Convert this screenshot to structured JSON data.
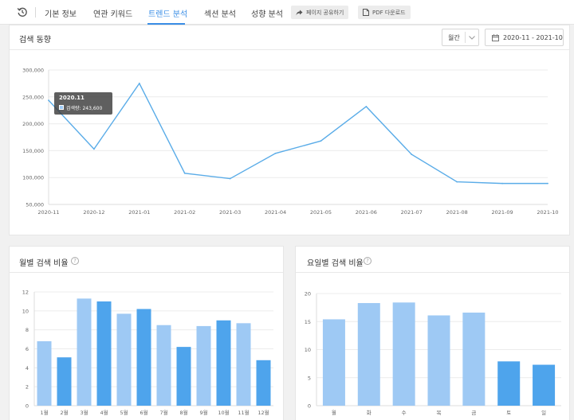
{
  "nav": {
    "tabs": [
      {
        "label": "기본 정보"
      },
      {
        "label": "연관 키워드"
      },
      {
        "label": "트렌드 분석"
      },
      {
        "label": "섹션 분석"
      },
      {
        "label": "성향 분석"
      }
    ],
    "share_label": "페이지 공유하기",
    "pdf_label": "PDF 다운로드"
  },
  "trend": {
    "title": "검색 동향",
    "period_select": "월간",
    "date_range": "2020-11 - 2021-10",
    "tooltip": {
      "title": "2020.11",
      "label": "검색량: 243,600"
    }
  },
  "monthly": {
    "title": "월별 검색 비율"
  },
  "weekday": {
    "title": "요일별 검색 비율"
  },
  "colors": {
    "line": "#5aace8",
    "bar_light": "#9ec9f4",
    "bar_dark": "#4ea4ec",
    "accent": "#3a8ee6"
  },
  "chart_data": [
    {
      "type": "line",
      "x": [
        "2020-11",
        "2020-12",
        "2021-01",
        "2021-02",
        "2021-03",
        "2021-04",
        "2021-05",
        "2021-06",
        "2021-07",
        "2021-08",
        "2021-09",
        "2021-10"
      ],
      "values": [
        243600,
        153000,
        275000,
        108000,
        98000,
        145000,
        168000,
        232000,
        143000,
        92000,
        89000,
        89000
      ],
      "ylim": [
        50000,
        300000
      ],
      "yticks": [
        "50,000",
        "100,000",
        "150,000",
        "200,000",
        "250,000",
        "300,000"
      ],
      "ytick_values": [
        50000,
        100000,
        150000,
        200000,
        250000,
        300000
      ],
      "grid": true
    },
    {
      "type": "bar",
      "categories": [
        "1월",
        "2월",
        "3월",
        "4월",
        "5월",
        "6월",
        "7월",
        "8월",
        "9월",
        "10월",
        "11월",
        "12월"
      ],
      "values": [
        6.8,
        5.1,
        11.3,
        11.0,
        9.7,
        10.2,
        8.5,
        6.2,
        8.4,
        9.0,
        8.7,
        4.8
      ],
      "highlight": [
        false,
        true,
        false,
        true,
        false,
        true,
        false,
        true,
        false,
        true,
        false,
        true
      ],
      "ylim": [
        0,
        12
      ],
      "yticks": [
        "0",
        "2",
        "4",
        "6",
        "8",
        "10",
        "12"
      ],
      "ytick_values": [
        0,
        2,
        4,
        6,
        8,
        10,
        12
      ]
    },
    {
      "type": "bar",
      "categories": [
        "월",
        "화",
        "수",
        "목",
        "금",
        "토",
        "일"
      ],
      "values": [
        15.4,
        18.3,
        18.4,
        16.1,
        16.6,
        7.9,
        7.3
      ],
      "highlight": [
        false,
        false,
        false,
        false,
        false,
        true,
        true
      ],
      "ylim": [
        0,
        20
      ],
      "yticks": [
        "0",
        "5",
        "10",
        "15",
        "20"
      ],
      "ytick_values": [
        0,
        5,
        10,
        15,
        20
      ]
    }
  ]
}
